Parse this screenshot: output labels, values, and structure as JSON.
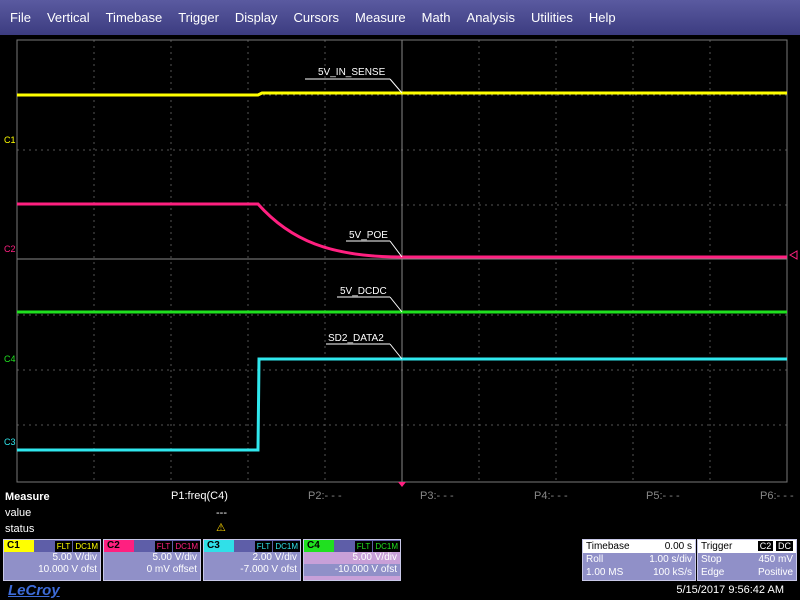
{
  "menu": [
    "File",
    "Vertical",
    "Timebase",
    "Trigger",
    "Display",
    "Cursors",
    "Measure",
    "Math",
    "Analysis",
    "Utilities",
    "Help"
  ],
  "traces": {
    "c1": {
      "label": "5V_IN_SENSE",
      "marker": "C1",
      "color": "#ffff00"
    },
    "c2": {
      "label": "5V_POE",
      "marker": "C2",
      "color": "#ff2080"
    },
    "c3": {
      "label": "5V_DCDC",
      "marker": "C3",
      "color": "#20e020"
    },
    "c4": {
      "label": "SD2_DATA2",
      "marker": "C4",
      "color": "#30e0e8"
    }
  },
  "measure": {
    "title": "Measure",
    "value_label": "value",
    "status_label": "status",
    "p1": "P1:freq(C4)",
    "p1_value": "---",
    "warning_icon": "warning-icon",
    "p2": "P2:- - -",
    "p3": "P3:- - -",
    "p4": "P4:- - -",
    "p5": "P5:- - -",
    "p6": "P6:- - -"
  },
  "channels": [
    {
      "name": "C1",
      "flt": "FLT",
      "coupling": "DC1M",
      "vdiv": "5.00 V/div",
      "offset": "10.000 V ofst",
      "color": "#ffff00"
    },
    {
      "name": "C2",
      "flt": "FLT",
      "coupling": "DC1M",
      "vdiv": "5.00 V/div",
      "offset": "0 mV offset",
      "color": "#ff2080"
    },
    {
      "name": "C3",
      "flt": "FLT",
      "coupling": "DC1M",
      "vdiv": "2.00 V/div",
      "offset": "-7.000 V ofst",
      "color": "#30e0e8"
    },
    {
      "name": "C4",
      "flt": "FLT",
      "coupling": "DC1M",
      "vdiv": "5.00 V/div",
      "offset": "-10.000 V ofst",
      "color": "#20e020"
    }
  ],
  "timebase": {
    "title": "Timebase",
    "delay": "0.00 s",
    "mode": "Roll",
    "tdiv": "1.00 s/div",
    "ms": "1.00 MS",
    "rate": "100 kS/s"
  },
  "trigger": {
    "title": "Trigger",
    "source": "C2",
    "coupling": "DC",
    "mode": "Stop",
    "level": "450 mV",
    "type": "Edge",
    "slope": "Positive"
  },
  "footer": {
    "logo": "LeCroy",
    "datetime": "5/15/2017 9:56:42 AM"
  }
}
